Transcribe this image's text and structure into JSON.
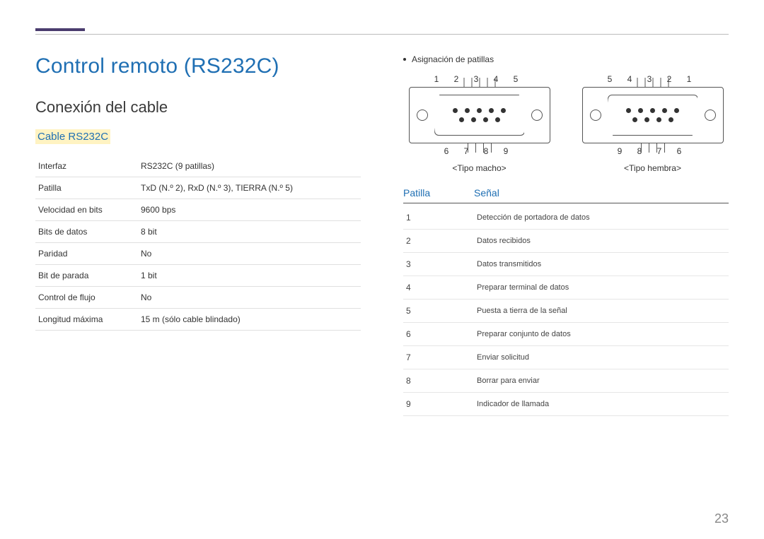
{
  "title": "Control remoto (RS232C)",
  "section": "Conexión del cable",
  "sub": "Cable RS232C",
  "spec_rows": [
    {
      "label": "Interfaz",
      "value": "RS232C (9 patillas)"
    },
    {
      "label": "Patilla",
      "value": "TxD (N.º 2), RxD (N.º 3), TIERRA (N.º 5)"
    },
    {
      "label": "Velocidad en bits",
      "value": "9600 bps"
    },
    {
      "label": "Bits de datos",
      "value": "8 bit"
    },
    {
      "label": "Paridad",
      "value": "No"
    },
    {
      "label": "Bit de parada",
      "value": "1 bit"
    },
    {
      "label": "Control de flujo",
      "value": "No"
    },
    {
      "label": "Longitud máxima",
      "value": "15 m (sólo cable blindado)"
    }
  ],
  "pin_assignment_label": "Asignación de patillas",
  "diagram": {
    "male": {
      "top_numbers": "1 2 3 4 5",
      "bottom_numbers": "6 7 8 9",
      "caption": "<Tipo macho>"
    },
    "female": {
      "top_numbers": "5 4 3 2 1",
      "bottom_numbers": "9 8 7 6",
      "caption": "<Tipo hembra>"
    }
  },
  "signal_headers": {
    "pin": "Patilla",
    "signal": "Señal"
  },
  "signal_rows": [
    {
      "pin": "1",
      "signal": "Detección de portadora de datos"
    },
    {
      "pin": "2",
      "signal": "Datos recibidos"
    },
    {
      "pin": "3",
      "signal": "Datos transmitidos"
    },
    {
      "pin": "4",
      "signal": "Preparar terminal de datos"
    },
    {
      "pin": "5",
      "signal": "Puesta a tierra de la señal"
    },
    {
      "pin": "6",
      "signal": "Preparar conjunto de datos"
    },
    {
      "pin": "7",
      "signal": "Enviar solicitud"
    },
    {
      "pin": "8",
      "signal": "Borrar para enviar"
    },
    {
      "pin": "9",
      "signal": "Indicador de llamada"
    }
  ],
  "page_number": "23"
}
